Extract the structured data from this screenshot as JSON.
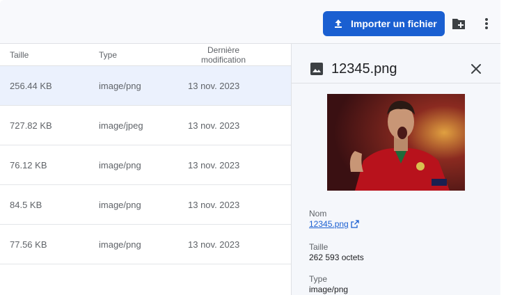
{
  "toolbar": {
    "upload_label": "Importer un fichier",
    "accent": "#1a5fd1",
    "icons": [
      "upload-icon",
      "new-folder-icon",
      "more-vert-icon"
    ]
  },
  "list": {
    "columns": {
      "size": "Taille",
      "type": "Type",
      "date": "Dernière modification"
    },
    "rows": [
      {
        "size": "256.44 KB",
        "type": "image/png",
        "date": "13 nov. 2023",
        "selected": true
      },
      {
        "size": "727.82 KB",
        "type": "image/jpeg",
        "date": "13 nov. 2023"
      },
      {
        "size": "76.12 KB",
        "type": "image/png",
        "date": "13 nov. 2023"
      },
      {
        "size": "84.5 KB",
        "type": "image/png",
        "date": "13 nov. 2023"
      },
      {
        "size": "77.56 KB",
        "type": "image/png",
        "date": "13 nov. 2023"
      }
    ]
  },
  "detail": {
    "title": "12345.png",
    "icons": [
      "image-icon",
      "close-icon",
      "open-in-new-icon"
    ],
    "preview": "photo-soccer-player-celebrating",
    "name_label": "Nom",
    "name_value": "12345.png",
    "size_label": "Taille",
    "size_value": "262 593 octets",
    "type_label": "Type",
    "type_value": "image/png"
  }
}
